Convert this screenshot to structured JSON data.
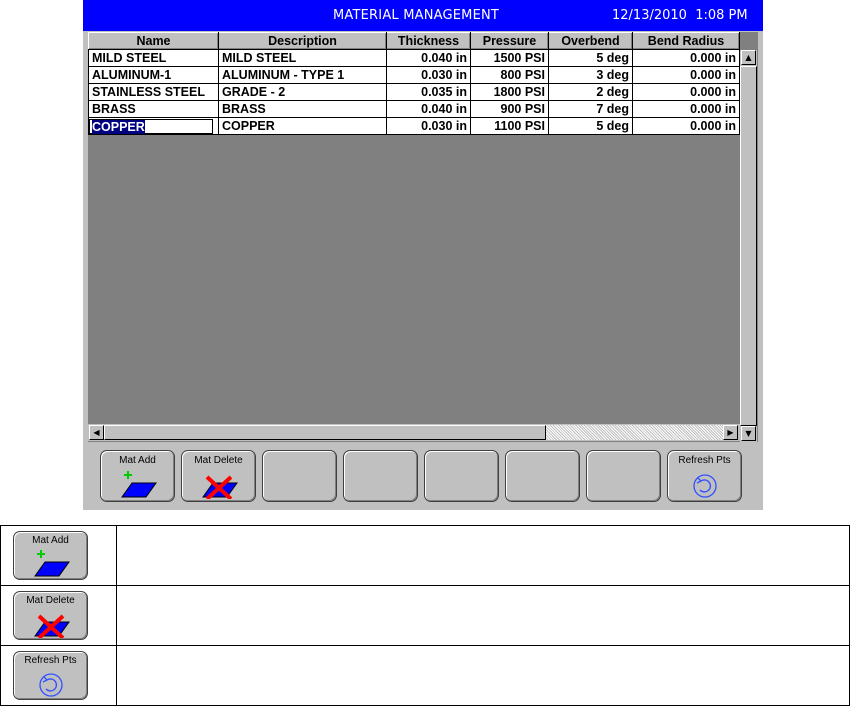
{
  "window": {
    "title": "MATERIAL MANAGEMENT",
    "datetime": "12/13/2010  1:08 PM",
    "title_bar_color": "#0000ff"
  },
  "grid": {
    "columns": [
      "Name",
      "Description",
      "Thickness",
      "Pressure",
      "Overbend",
      "Bend Radius"
    ],
    "rows": [
      [
        "MILD STEEL",
        "MILD STEEL",
        "0.040 in",
        "1500 PSI",
        "5 deg",
        "0.000 in"
      ],
      [
        "ALUMINUM-1",
        "ALUMINUM - TYPE 1",
        "0.030 in",
        "800 PSI",
        "3 deg",
        "0.000 in"
      ],
      [
        "STAINLESS STEEL",
        "GRADE - 2",
        "0.035 in",
        "1800 PSI",
        "2 deg",
        "0.000 in"
      ],
      [
        "BRASS",
        "BRASS",
        "0.040 in",
        "900 PSI",
        "7 deg",
        "0.000 in"
      ],
      [
        "COPPER",
        "COPPER",
        "0.030 in",
        "1100 PSI",
        "5 deg",
        "0.000 in"
      ]
    ],
    "selected_row": 4,
    "selection_color": "#000080",
    "background_color": "#808080"
  },
  "scrollbars": {
    "up_icon": "arrow-up-icon",
    "down_icon": "arrow-down-icon",
    "left_icon": "arrow-left-icon",
    "right_icon": "arrow-right-icon"
  },
  "function_keys": [
    {
      "label": "Mat Add",
      "icon": "material-add-icon"
    },
    {
      "label": "Mat Delete",
      "icon": "material-delete-icon"
    },
    {
      "label": "",
      "icon": ""
    },
    {
      "label": "",
      "icon": ""
    },
    {
      "label": "",
      "icon": ""
    },
    {
      "label": "",
      "icon": ""
    },
    {
      "label": "",
      "icon": ""
    },
    {
      "label": "Refresh Pts",
      "icon": "refresh-icon"
    }
  ],
  "legend": [
    {
      "label": "Mat Add",
      "icon": "material-add-icon",
      "description": ""
    },
    {
      "label": "Mat Delete",
      "icon": "material-delete-icon",
      "description": ""
    },
    {
      "label": "Refresh Pts",
      "icon": "refresh-icon",
      "description": ""
    }
  ]
}
